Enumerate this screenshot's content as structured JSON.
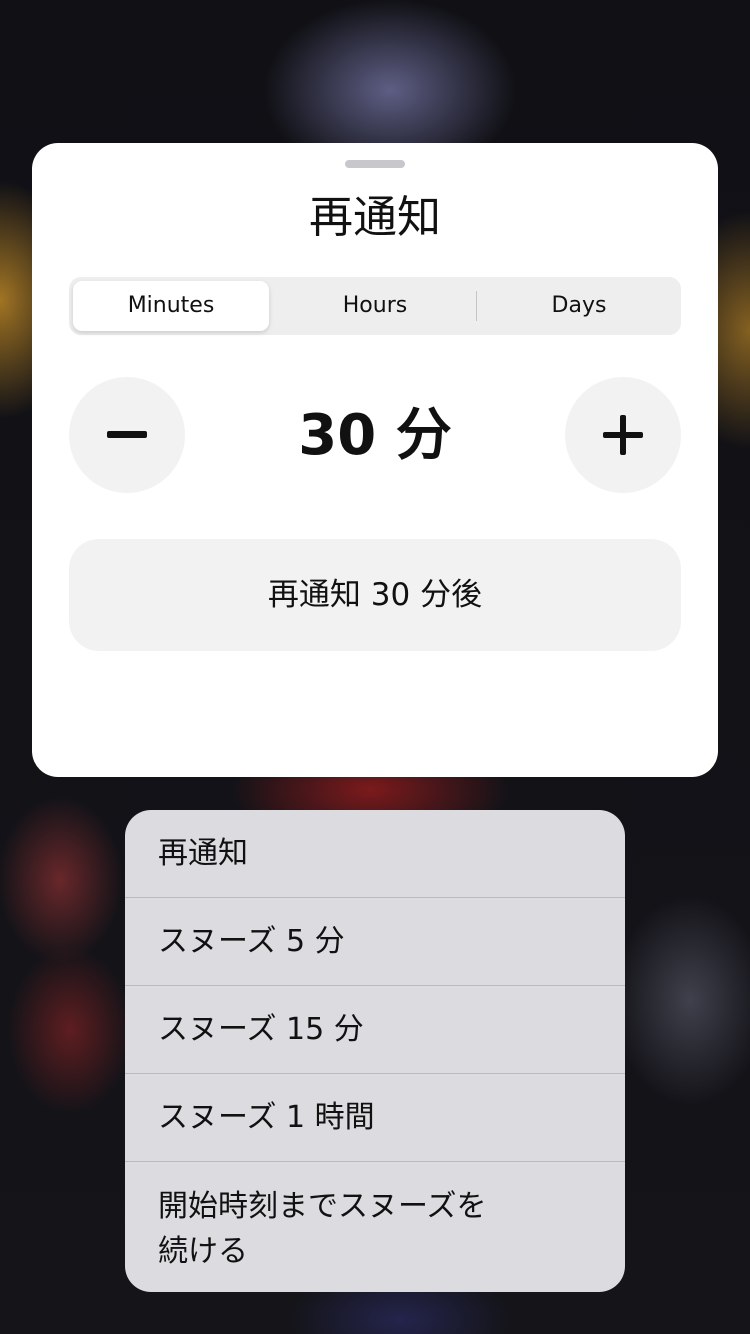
{
  "snooze_card": {
    "title": "再通知",
    "segments": [
      {
        "label": "Minutes",
        "selected": true
      },
      {
        "label": "Hours",
        "selected": false
      },
      {
        "label": "Days",
        "selected": false
      }
    ],
    "stepper": {
      "value_label": "30 分"
    },
    "confirm_label": "再通知 30 分後"
  },
  "context_menu": {
    "items": [
      {
        "label": "再通知"
      },
      {
        "label": "スヌーズ 5 分"
      },
      {
        "label": "スヌーズ 15 分"
      },
      {
        "label": "スヌーズ 1 時間"
      },
      {
        "label": "開始時刻までスヌーズを\n続ける"
      }
    ]
  },
  "icons": {
    "decrement": "minus-icon",
    "increment": "plus-icon"
  },
  "colors": {
    "card_background": "#ffffff",
    "button_background": "#f2f2f3",
    "segment_track": "#eeeeef",
    "menu_background": "#dcdce0",
    "text": "#111111"
  }
}
